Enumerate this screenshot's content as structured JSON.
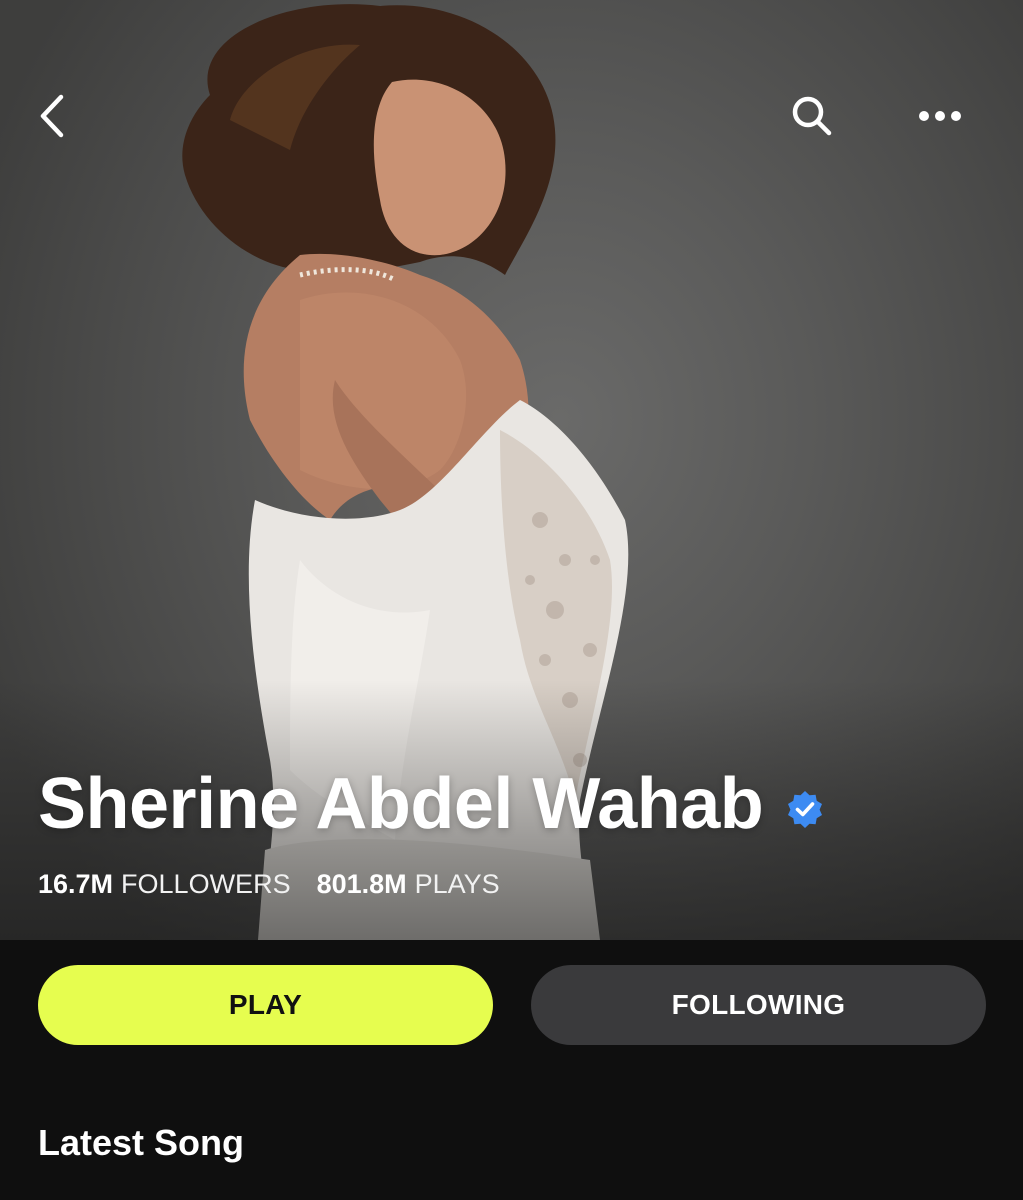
{
  "artist": {
    "name": "Sherine Abdel Wahab",
    "verified": true,
    "followers_count": "16.7M",
    "followers_label": "FOLLOWERS",
    "plays_count": "801.8M",
    "plays_label": "PLAYS"
  },
  "nav": {
    "back_icon": "chevron-left-icon",
    "search_icon": "search-icon",
    "more_icon": "more-horizontal-icon"
  },
  "actions": {
    "play_label": "PLAY",
    "following_label": "FOLLOWING"
  },
  "sections": {
    "latest_song_title": "Latest Song"
  },
  "colors": {
    "accent": "#e6fd4f",
    "secondary_button": "#3a3a3c",
    "background": "#0f0f0f",
    "verified_badge": "#3d8bf2"
  }
}
